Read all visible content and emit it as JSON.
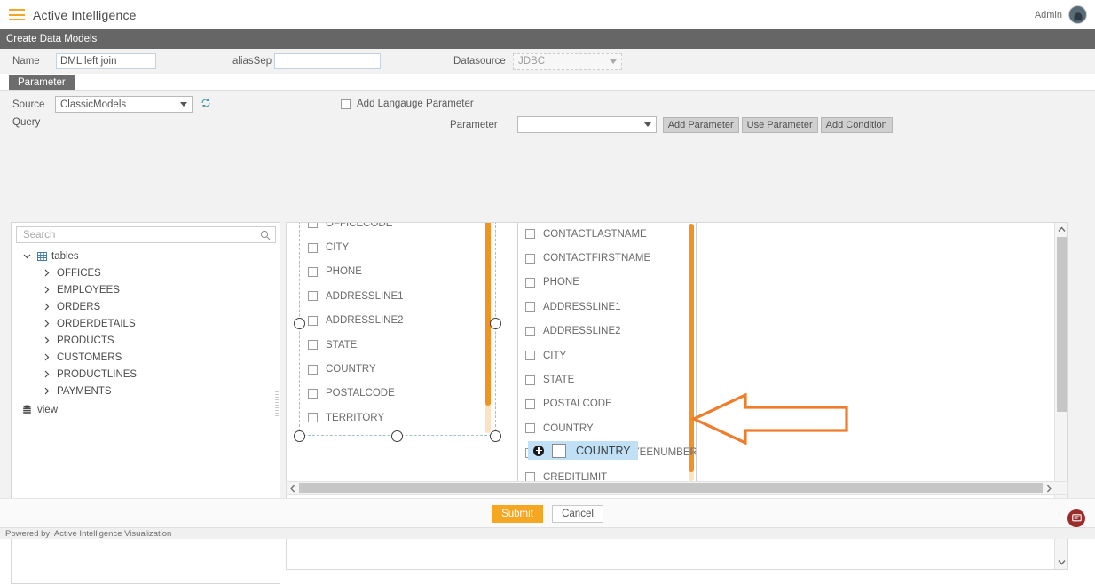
{
  "topbar": {
    "menu_icon": "hamburger-icon",
    "app_title": "Active Intelligence",
    "user_label": "Admin",
    "avatar_icon": "user-avatar"
  },
  "page": {
    "title": "Create Data Models"
  },
  "form": {
    "name_label": "Name",
    "name_value": "DML left join",
    "alias_label": "aliasSep",
    "alias_value": "",
    "alias_placeholder": "",
    "datasource_label": "Datasource",
    "datasource_value": "JDBC"
  },
  "tab": {
    "label": "Parameter"
  },
  "source": {
    "label": "Source",
    "value": "ClassicModels",
    "refresh_icon": "refresh-icon",
    "lang_param_label": "Add Langauge Parameter",
    "lang_param_checked": false
  },
  "query": {
    "label": "Query"
  },
  "parameter": {
    "label": "Parameter",
    "value": "",
    "add_parameter_label": "Add Parameter",
    "use_parameter_label": "Use Parameter",
    "add_condition_label": "Add Condition"
  },
  "search": {
    "placeholder": "Search",
    "value": "",
    "icon": "search-icon"
  },
  "tree": {
    "root": {
      "label": "tables",
      "icon": "table-icon",
      "expanded": true
    },
    "children": [
      {
        "label": "OFFICES",
        "icon": "chevron-right-icon"
      },
      {
        "label": "EMPLOYEES",
        "icon": "chevron-right-icon"
      },
      {
        "label": "ORDERS",
        "icon": "chevron-right-icon"
      },
      {
        "label": "ORDERDETAILS",
        "icon": "chevron-right-icon"
      },
      {
        "label": "PRODUCTS",
        "icon": "chevron-right-icon"
      },
      {
        "label": "CUSTOMERS",
        "icon": "chevron-right-icon"
      },
      {
        "label": "PRODUCTLINES",
        "icon": "chevron-right-icon"
      },
      {
        "label": "PAYMENTS",
        "icon": "chevron-right-icon"
      }
    ],
    "view": {
      "label": "view",
      "icon": "view-icon"
    }
  },
  "canvas": {
    "left_table": {
      "selected": true,
      "fields": [
        {
          "label": "OFFICECODE",
          "checked": false
        },
        {
          "label": "CITY",
          "checked": false
        },
        {
          "label": "PHONE",
          "checked": false
        },
        {
          "label": "ADDRESSLINE1",
          "checked": false
        },
        {
          "label": "ADDRESSLINE2",
          "checked": false
        },
        {
          "label": "STATE",
          "checked": false
        },
        {
          "label": "COUNTRY",
          "checked": false
        },
        {
          "label": "POSTALCODE",
          "checked": false
        },
        {
          "label": "TERRITORY",
          "checked": false
        }
      ]
    },
    "right_table": {
      "fields": [
        {
          "label": "CONTACTLASTNAME",
          "checked": false
        },
        {
          "label": "CONTACTFIRSTNAME",
          "checked": false
        },
        {
          "label": "PHONE",
          "checked": false
        },
        {
          "label": "ADDRESSLINE1",
          "checked": false
        },
        {
          "label": "ADDRESSLINE2",
          "checked": false
        },
        {
          "label": "CITY",
          "checked": false
        },
        {
          "label": "STATE",
          "checked": false
        },
        {
          "label": "POSTALCODE",
          "checked": false
        },
        {
          "label": "COUNTRY",
          "checked": false
        },
        {
          "label": "SALESREPEMPLOYEENUMBER",
          "checked": false
        },
        {
          "label": "CREDITLIMIT",
          "checked": false
        }
      ]
    },
    "drag_ghost": {
      "label": "COUNTRY",
      "icon": "plus-circle-icon",
      "checked": false
    },
    "annotation_arrow": {
      "icon": "left-arrow-annotation",
      "color": "#f07d2b"
    }
  },
  "scrollbars": {
    "up_icon": "chevron-up-icon",
    "down_icon": "chevron-down-icon",
    "left_icon": "chevron-left-icon",
    "right_icon": "chevron-right-icon"
  },
  "actions": {
    "submit_label": "Submit",
    "cancel_label": "Cancel"
  },
  "footer": {
    "text": "Powered by: Active Intelligence Visualization",
    "chat_icon": "chat-icon"
  },
  "colors": {
    "accent": "#f5a623",
    "pagebar": "#666666",
    "highlight": "#bfe0f5",
    "annotation": "#f07d2b"
  }
}
